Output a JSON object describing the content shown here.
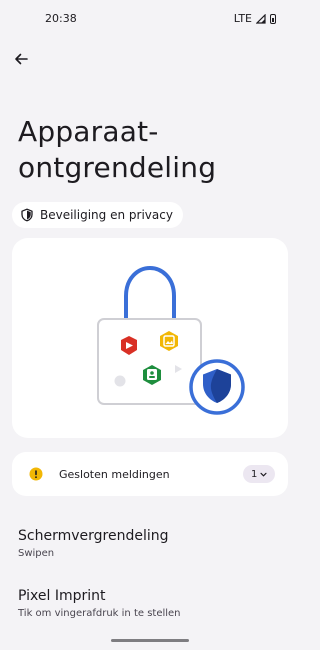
{
  "status_bar": {
    "time": "20:38",
    "network": "LTE"
  },
  "header": {
    "title": "Apparaat-\nontgrendeling"
  },
  "chip": {
    "label": "Beveiliging en privacy"
  },
  "notifications_card": {
    "label": "Gesloten meldingen",
    "count": "1"
  },
  "settings": [
    {
      "title": "Schermvergrendeling",
      "summary": "Swipen"
    },
    {
      "title": "Pixel Imprint",
      "summary": "Tik om vingerafdruk in te stellen"
    }
  ],
  "icons": {
    "back": "arrow-back-icon",
    "chip": "shield-icon",
    "notification": "warning-icon",
    "count_chevron": "chevron-down-icon"
  },
  "colors": {
    "background": "#f4f3f6",
    "card": "#ffffff",
    "lock_shackle": "#3a6fd8",
    "warning": "#f2b705",
    "shield": "#2f5fc8"
  }
}
